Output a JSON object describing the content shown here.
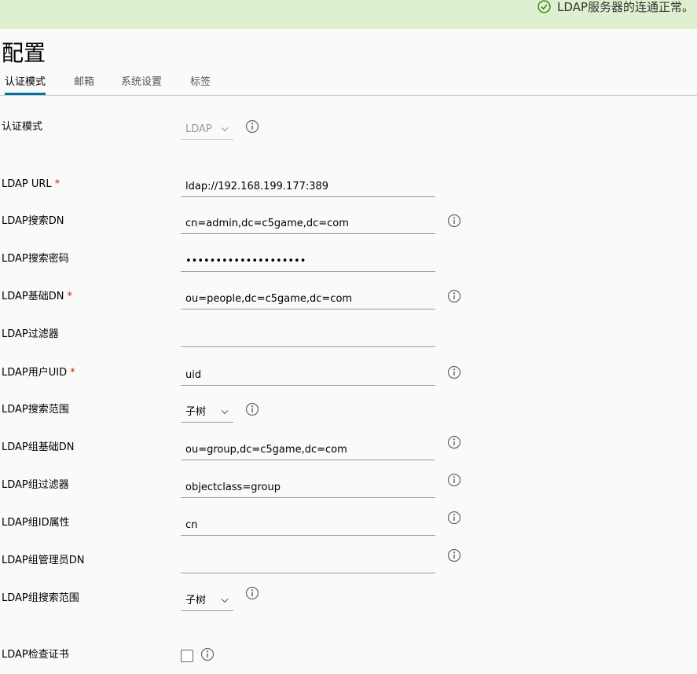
{
  "banner": {
    "message": "LDAP服务器的连通正常。"
  },
  "page": {
    "title": "配置"
  },
  "tabs": [
    {
      "label": "认证模式",
      "active": true
    },
    {
      "label": "邮箱",
      "active": false
    },
    {
      "label": "系统设置",
      "active": false
    },
    {
      "label": "标签",
      "active": false
    }
  ],
  "form": {
    "auth_mode": {
      "label": "认证模式",
      "value": "LDAP"
    },
    "ldap_url": {
      "label": "LDAP URL",
      "required": "*",
      "value": "ldap://192.168.199.177:389"
    },
    "search_dn": {
      "label": "LDAP搜索DN",
      "value": "cn=admin,dc=c5game,dc=com"
    },
    "search_password": {
      "label": "LDAP搜索密码",
      "value": "••••••••••••••••••••"
    },
    "base_dn": {
      "label": "LDAP基础DN",
      "required": "*",
      "value": "ou=people,dc=c5game,dc=com"
    },
    "filter": {
      "label": "LDAP过滤器",
      "value": ""
    },
    "uid": {
      "label": "LDAP用户UID",
      "required": "*",
      "value": "uid"
    },
    "scope": {
      "label": "LDAP搜索范围",
      "value": "子树"
    },
    "group_base_dn": {
      "label": "LDAP组基础DN",
      "value": "ou=group,dc=c5game,dc=com"
    },
    "group_filter": {
      "label": "LDAP组过滤器",
      "value": "objectclass=group"
    },
    "group_gid": {
      "label": "LDAP组ID属性",
      "value": "cn"
    },
    "group_admin_dn": {
      "label": "LDAP组管理员DN",
      "value": ""
    },
    "group_scope": {
      "label": "LDAP组搜索范围",
      "value": "子树"
    },
    "verify_cert": {
      "label": "LDAP检查证书",
      "checked": false
    }
  },
  "colors": {
    "banner_bg": "#dff0d0",
    "success": "#2f8400",
    "tab_active": "#0072a3",
    "required": "#c92100"
  },
  "icons": {
    "banner": "check-circle-icon",
    "info": "info-circle-icon",
    "select": "chevron-down-icon"
  }
}
